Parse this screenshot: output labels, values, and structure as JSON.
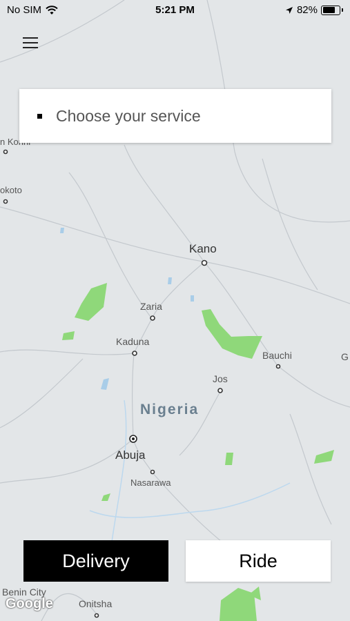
{
  "status_bar": {
    "carrier": "No SIM",
    "time": "5:21 PM",
    "battery_percent": "82%",
    "battery_level": 0.82,
    "icons": [
      "wifi-icon",
      "location-arrow-icon",
      "battery-icon"
    ]
  },
  "menu": {
    "icon": "hamburger-menu-icon"
  },
  "service_selector": {
    "placeholder": "Choose your service"
  },
  "map": {
    "labels": {
      "kano": "Kano",
      "zaria": "Zaria",
      "kaduna": "Kaduna",
      "bauchi": "Bauchi",
      "jos": "Jos",
      "country": "Nigeria",
      "abuja": "Abuja",
      "nasarawa": "Nasarawa",
      "benin_city": "Benin City",
      "onitsha": "Onitsha",
      "konni_partial": "n Konni",
      "sokoto_partial": "okoto",
      "g_partial": "G"
    },
    "attribution": "Google",
    "colors": {
      "land": "#e3e6e8",
      "park": "#8fd87a",
      "water": "#a9cde8",
      "road": "#c7ccd1"
    }
  },
  "actions": {
    "delivery_label": "Delivery",
    "ride_label": "Ride"
  }
}
